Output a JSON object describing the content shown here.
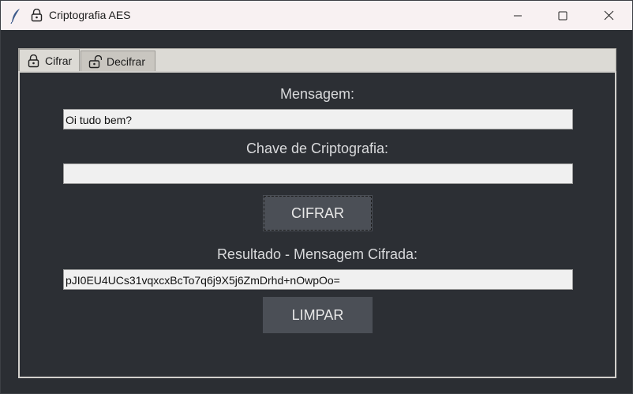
{
  "window": {
    "title": "Criptografia AES"
  },
  "tabs": [
    {
      "label": "Cifrar",
      "icon": "lock-icon",
      "selected": true
    },
    {
      "label": "Decifrar",
      "icon": "unlock-icon",
      "selected": false
    }
  ],
  "form": {
    "message_label": "Mensagem:",
    "message_value": "Oi tudo bem?",
    "key_label": "Chave de Criptografia:",
    "key_value": "",
    "encrypt_button": "CIFRAR",
    "result_label": "Resultado - Mensagem Cifrada:",
    "result_value": "pJI0EU4UCs31vqxcxBcTo7q6j9X5j6ZmDrhd+nOwpOo=",
    "clear_button": "LIMPAR"
  },
  "colors": {
    "background": "#2b2e33",
    "button": "#4b4f56",
    "label_text": "#d9dadc"
  }
}
